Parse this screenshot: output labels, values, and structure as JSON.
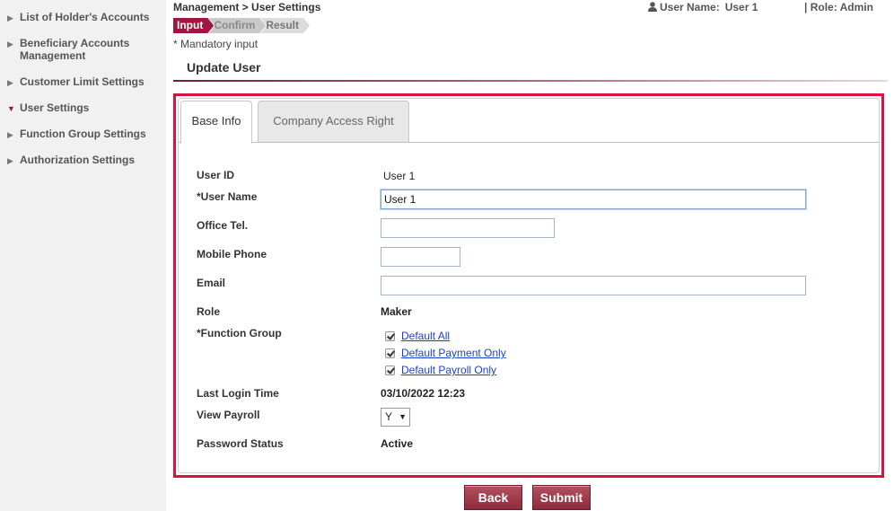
{
  "sidebar": {
    "items": [
      {
        "label": "List of Holder's Accounts"
      },
      {
        "label": "Beneficiary Accounts Management"
      },
      {
        "label": "Customer Limit Settings"
      },
      {
        "label": "User Settings"
      },
      {
        "label": "Function Group Settings"
      },
      {
        "label": "Authorization Settings"
      }
    ],
    "collapsed_marker": "▶",
    "expanded_marker": "▼"
  },
  "header": {
    "breadcrumb": "Management > User Settings",
    "user_name_label": "User Name:",
    "user_name_value": "User 1",
    "role_text": "| Role: Admin"
  },
  "steps": [
    "Input",
    "Confirm",
    "Result"
  ],
  "mandatory_note": "* Mandatory input",
  "page_title": "Update User",
  "tabs": [
    {
      "label": "Base Info",
      "active": true
    },
    {
      "label": "Company Access Right",
      "active": false
    }
  ],
  "form": {
    "user_id_label": "User ID",
    "user_id_value": "User 1",
    "user_name_label": "*User Name",
    "user_name_value": "User 1",
    "office_tel_label": "Office Tel.",
    "office_tel_value": "",
    "mobile_phone_label": "Mobile Phone",
    "mobile_phone_value": "",
    "email_label": "Email",
    "email_value": "",
    "role_label": "Role",
    "role_value": "Maker",
    "function_group_label": "*Function Group",
    "function_groups": [
      {
        "label": "Default All",
        "checked": true
      },
      {
        "label": "Default Payment Only",
        "checked": true
      },
      {
        "label": "Default Payroll Only",
        "checked": true
      }
    ],
    "last_login_label": "Last Login Time",
    "last_login_value": "03/10/2022 12:23",
    "view_payroll_label": "View Payroll",
    "view_payroll_value": "Y",
    "dropdown_arrow": "▼",
    "password_status_label": "Password Status",
    "password_status_value": "Active"
  },
  "buttons": {
    "back": "Back",
    "submit": "Submit"
  },
  "colors": {
    "accent": "#a0163f",
    "panel_border": "#d8143e",
    "link": "#1a3fd6",
    "button": "#9a3346"
  },
  "icons": {
    "user": "user-icon"
  }
}
